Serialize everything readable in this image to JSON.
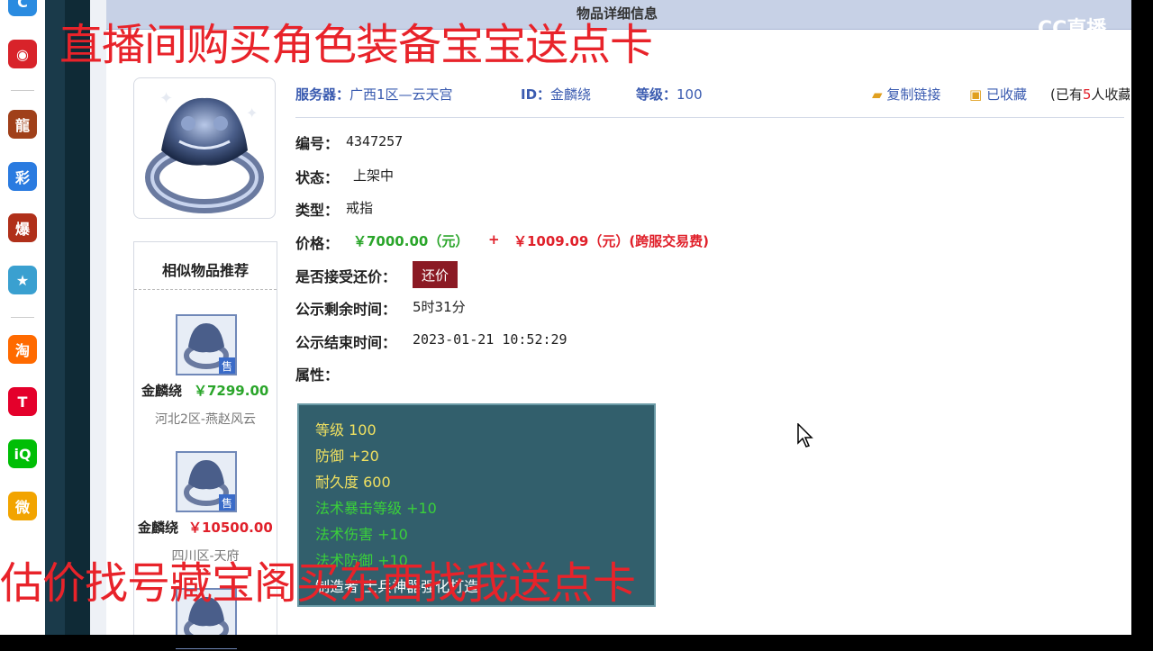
{
  "window": {
    "title": "物品详细信息"
  },
  "dock": {
    "items": [
      {
        "icon": "cc-icon",
        "glyph": "C",
        "color": "#2a8be0"
      },
      {
        "icon": "netease-music-icon",
        "glyph": "◉",
        "color": "#d8232a"
      },
      {
        "icon": "game-dragon-icon",
        "glyph": "龍",
        "color": "#a0401a"
      },
      {
        "icon": "game-color-icon",
        "glyph": "彩",
        "color": "#2a7be0"
      },
      {
        "icon": "game-fire-icon",
        "glyph": "爆",
        "color": "#b0301a"
      },
      {
        "icon": "game-cartoon-icon",
        "glyph": "★",
        "color": "#3aa0d0"
      },
      {
        "icon": "taobao-icon",
        "glyph": "淘",
        "color": "#ff6a00"
      },
      {
        "icon": "tmall-icon",
        "glyph": "T",
        "color": "#e4002b"
      },
      {
        "icon": "iqiyi-icon",
        "glyph": "iQ",
        "color": "#00be06"
      },
      {
        "icon": "weibo-icon",
        "glyph": "微",
        "color": "#f2a400"
      }
    ]
  },
  "item": {
    "server_label": "服务器：",
    "server_value": "广西1区—云天宫",
    "id_label": "ID：",
    "id_value": "金麟绕",
    "level_label": "等级：",
    "level_value": "100",
    "copy_link": "复制链接",
    "favorited": "已收藏",
    "fav_count_prefix": "(已有",
    "fav_count_number": "5",
    "fav_count_suffix": "人收藏",
    "number_label": "编号：",
    "number_value": "4347257",
    "status_label": "状态：",
    "status_value": "上架中",
    "type_label": "类型：",
    "type_value": "戒指",
    "price_label": "价格：",
    "price_value": "￥7000.00（元）",
    "price_plus": "+",
    "fee_value": "￥1009.09（元）(跨服交易费)",
    "counter_label": "是否接受还价：",
    "counter_button": "还价",
    "remaining_label": "公示剩余时间：",
    "remaining_value": "5时31分",
    "end_label": "公示结束时间：",
    "end_value": "2023-01-21 10:52:29",
    "attrs_label": "属性："
  },
  "attributes": [
    {
      "text": "等级 100",
      "color": "#f0e060"
    },
    {
      "text": "防御 +20",
      "color": "#f0e060"
    },
    {
      "text": "耐久度 600",
      "color": "#f0e060"
    },
    {
      "text": "法术暴击等级 +10",
      "color": "#3ad03a"
    },
    {
      "text": "法术伤害 +10",
      "color": "#3ad03a"
    },
    {
      "text": "法术防御 +10",
      "color": "#3ad03a"
    },
    {
      "text": "制造者 士兵神器强化打造",
      "color": "#ffffff"
    }
  ],
  "similar": {
    "title": "相似物品推荐",
    "sale_tag": "售",
    "items": [
      {
        "name": "金麟绕",
        "price": "￥7299.00",
        "price_color": "#2aa52a",
        "server": "河北2区-燕赵风云"
      },
      {
        "name": "金麟绕",
        "price": "￥10500.00",
        "price_color": "#e0202a",
        "server": "四川区-天府"
      }
    ]
  },
  "overlay": {
    "top": "直播间购买角色装备宝宝送点卡",
    "bottom": "估价找号藏宝阁买东西找我送点卡"
  },
  "watermark": {
    "small": "CC直播",
    "big": "CC直播"
  }
}
